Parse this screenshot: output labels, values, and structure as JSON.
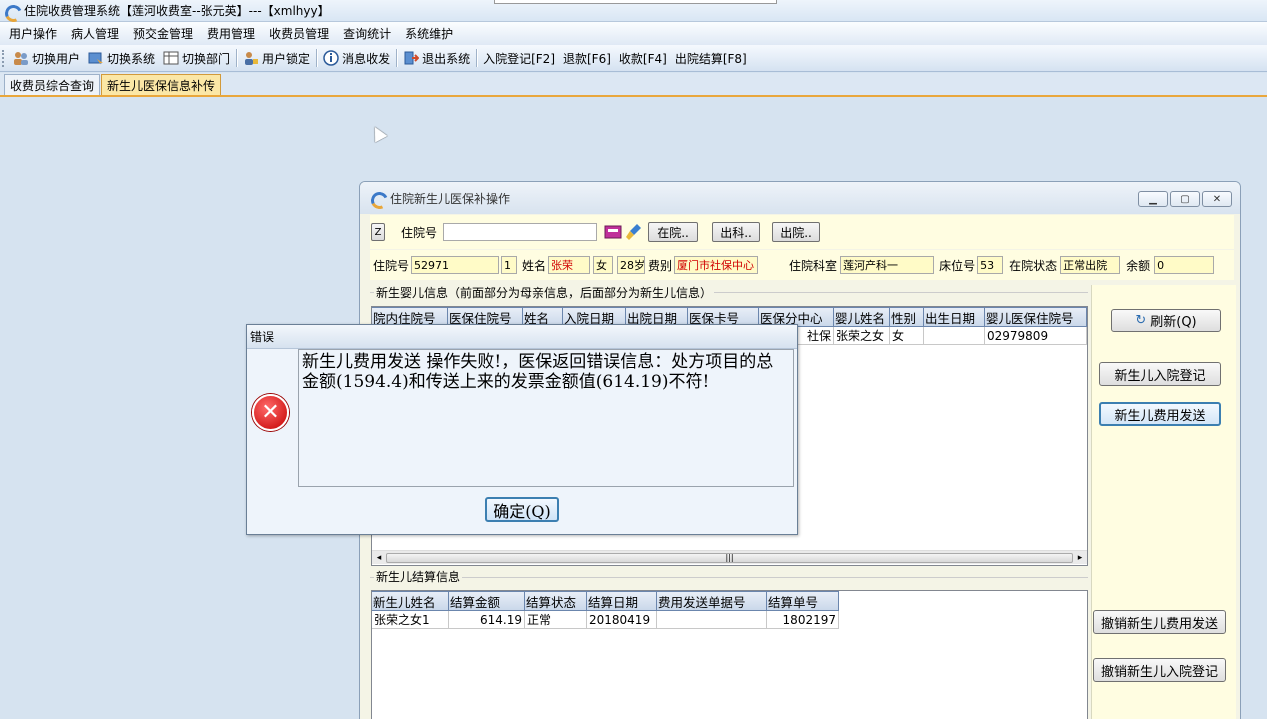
{
  "app": {
    "title": "住院收费管理系统【莲河收费室--张元英】---【xmlhyy】"
  },
  "menu": [
    "用户操作",
    "病人管理",
    "预交金管理",
    "费用管理",
    "收费员管理",
    "查询统计",
    "系统维护"
  ],
  "toolbar": {
    "switch_user": "切换用户",
    "switch_system": "切换系统",
    "switch_dept": "切换部门",
    "user_lock": "用户锁定",
    "messages": "消息收发",
    "exit": "退出系统",
    "admit": "入院登记[F2]",
    "refund": "退款[F6]",
    "charge": "收款[F4]",
    "discharge": "出院结算[F8]"
  },
  "tabs": [
    "收费员综合查询",
    "新生儿医保信息补传"
  ],
  "child": {
    "title": "住院新生儿医保补操作",
    "z_label": "Z",
    "search_label": "住院号",
    "search_value": "",
    "btn_in": "在院..",
    "btn_out_dept": "出科..",
    "btn_out": "出院..",
    "info": {
      "admission_label": "住院号",
      "admission_no": "52971",
      "times": "1",
      "name_label": "姓名",
      "name": "张荣",
      "sex": "女",
      "age": "28岁",
      "fee_type_label": "费别",
      "fee_type": "厦门市社保中心",
      "dept_label": "住院科室",
      "dept": "莲河产科一",
      "bed_label": "床位号",
      "bed": "53",
      "status_label": "在院状态",
      "status": "正常出院",
      "balance_label": "余额",
      "balance": "0"
    },
    "baby_group_title": "新生婴儿信息（前面部分为母亲信息，后面部分为新生儿信息）",
    "baby_columns": [
      "院内住院号",
      "医保住院号",
      "姓名",
      "入院日期",
      "出院日期",
      "医保卡号",
      "医保分中心",
      "婴儿姓名",
      "性别",
      "出生日期",
      "婴儿医保住院号"
    ],
    "baby_rows": [
      [
        "",
        "",
        "",
        "",
        "",
        "",
        "社保",
        "张荣之女",
        "女",
        "",
        "02979809"
      ]
    ],
    "settle_group_title": "新生儿结算信息",
    "settle_columns": [
      "新生儿姓名",
      "结算金额",
      "结算状态",
      "结算日期",
      "费用发送单据号",
      "结算单号"
    ],
    "settle_rows": [
      [
        "张荣之女1",
        "614.19",
        "正常",
        "20180419",
        "",
        "1802197"
      ]
    ],
    "buttons": {
      "refresh": "刷新(Q)",
      "baby_admit": "新生儿入院登记",
      "baby_send": "新生儿费用发送",
      "cancel_send": "撤销新生儿费用发送",
      "cancel_admit": "撤销新生儿入院登记"
    }
  },
  "dialog": {
    "title": "错误",
    "message": "新生儿费用发送 操作失败!，医保返回错误信息：处方项目的总金额(1594.4)和传送上来的发票金额值(614.19)不符!",
    "ok": "确定(Q)"
  }
}
